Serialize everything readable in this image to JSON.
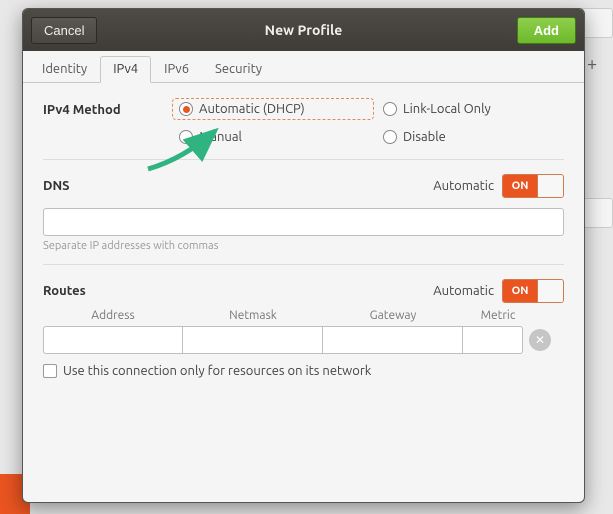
{
  "titlebar": {
    "cancel": "Cancel",
    "title": "New Profile",
    "add": "Add"
  },
  "tabs": [
    {
      "label": "Identity",
      "active": false
    },
    {
      "label": "IPv4",
      "active": true
    },
    {
      "label": "IPv6",
      "active": false
    },
    {
      "label": "Security",
      "active": false
    }
  ],
  "ipv4": {
    "section_label": "IPv4 Method",
    "options": {
      "automatic": "Automatic (DHCP)",
      "link_local": "Link-Local Only",
      "manual": "Manual",
      "disable": "Disable"
    },
    "selected": "automatic"
  },
  "dns": {
    "heading": "DNS",
    "auto_label": "Automatic",
    "switch_text": "ON",
    "value": "",
    "hint": "Separate IP addresses with commas"
  },
  "routes": {
    "heading": "Routes",
    "auto_label": "Automatic",
    "switch_text": "ON",
    "headers": {
      "address": "Address",
      "netmask": "Netmask",
      "gateway": "Gateway",
      "metric": "Metric"
    },
    "row": {
      "address": "",
      "netmask": "",
      "gateway": "",
      "metric": ""
    }
  },
  "checkbox": {
    "label": "Use this connection only for resources on its network",
    "checked": false
  },
  "colors": {
    "accent": "#e95420",
    "add_button": "#6db92b"
  }
}
